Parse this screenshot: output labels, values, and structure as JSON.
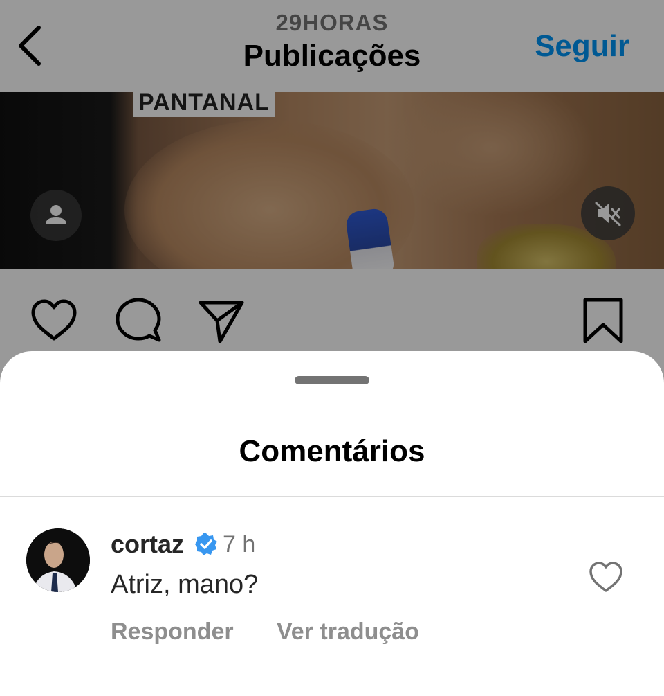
{
  "header": {
    "account": "29HORAS",
    "title": "Publicações",
    "follow_label": "Seguir"
  },
  "post": {
    "overlay_text": "PANTANAL"
  },
  "icons": {
    "back": "chevron-left-icon",
    "user_tag": "person-icon",
    "mute": "speaker-muted-icon",
    "like": "heart-icon",
    "comment": "speech-bubble-icon",
    "share": "paper-plane-icon",
    "save": "bookmark-icon",
    "verified": "verified-badge-icon"
  },
  "comments_sheet": {
    "title": "Comentários",
    "comments": [
      {
        "username": "cortaz",
        "verified": true,
        "time": "7 h",
        "text": "Atriz, mano?",
        "reply_label": "Responder",
        "translate_label": "Ver tradução"
      }
    ]
  },
  "colors": {
    "link_blue": "#0095f6",
    "verified_blue": "#3897f0",
    "secondary_text": "#8e8e8e"
  }
}
